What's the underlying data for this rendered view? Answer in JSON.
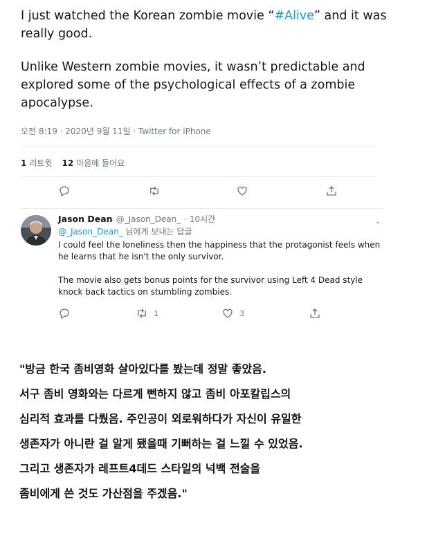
{
  "tweet": {
    "line1_prefix": "I just watched the Korean zombie movie “",
    "hashtag": "#Alive",
    "line1_suffix": "” and it was really good.",
    "paragraph2": "Unlike Western zombie movies, it wasn’t predictable and explored some of the psychological effects of a zombie apocalypse.",
    "meta": "오전 8:19 · 2020년 9월 11일 · Twitter for iPhone",
    "retweets_count": "1",
    "retweets_label": "리트윗",
    "likes_count": "12",
    "likes_label": "마음에 들어요"
  },
  "reply": {
    "name": "Jason Dean",
    "handle": "@_Jason_Dean_",
    "time": "· 10시간",
    "mention": "@_Jason_Dean_",
    "replying_suffix": " 님에게 보내는 답글",
    "text1": "I could feel the loneliness then the happiness that the protagonist feels when he learns that he isn't the only survivor.",
    "text2": "The movie also gets bonus points for the survivor using Left 4 Dead style knock back tactics on stumbling zombies.",
    "retweet_count": "1",
    "like_count": "3"
  },
  "translation": {
    "line1": "\"방금 한국 좀비영화 살아있다를 봤는데 정말 좋았음.",
    "line2": "서구 좀비 영화와는 다르게 뻔하지 않고 좀비 아포칼립스의",
    "line3": "심리적 효과를 다뤘음. 주인공이 외로워하다가 자신이 유일한",
    "line4": "생존자가 아니란 걸 알게 됐을때 기뻐하는 걸 느낄 수 있었음.",
    "line5": "그리고 생존자가 레프트4데드 스타일의 넉백 전술을",
    "line6": "좀비에게 쓴 것도 가산점을 주겠음.\""
  },
  "colors": {
    "accent": "#1b95e0",
    "muted": "#657786",
    "text": "#14171a",
    "divider": "#e6ecf0"
  }
}
